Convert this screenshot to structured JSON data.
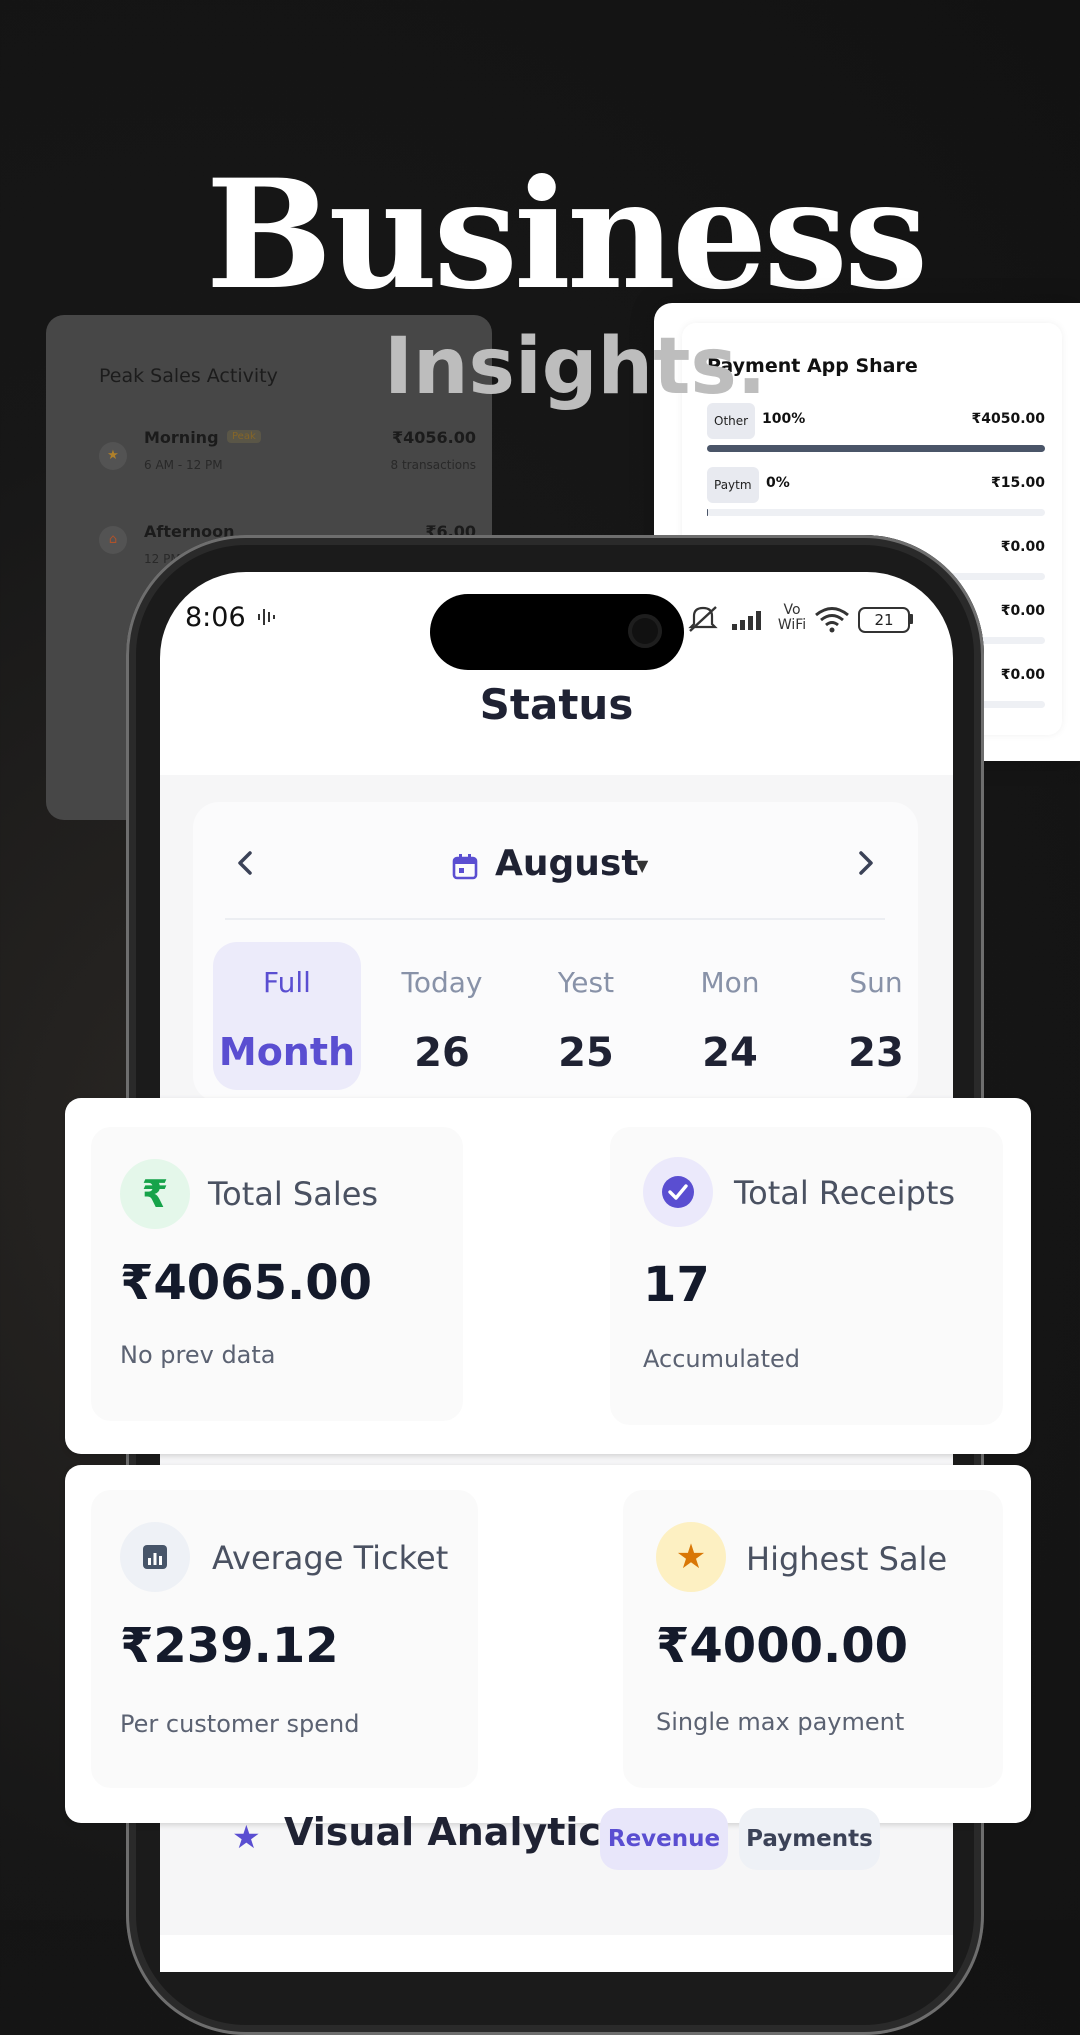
{
  "hero": {
    "title": "Business",
    "subtitle": "Insights."
  },
  "peak_sales": {
    "title": "Peak Sales Activity",
    "rows": [
      {
        "name": "Morning",
        "badge": "Peak",
        "time": "6 AM - 12 PM",
        "amount": "₹4056.00",
        "transactions": "8 transactions",
        "icon": "star-icon"
      },
      {
        "name": "Afternoon",
        "time": "12 PM",
        "amount": "₹6.00",
        "icon": "home-icon"
      }
    ]
  },
  "payment_share": {
    "title": "Payment App Share",
    "rows": [
      {
        "app": "Other",
        "percent": "100%",
        "amount": "₹4050.00",
        "share": 1.0
      },
      {
        "app": "Paytm",
        "percent": "0%",
        "amount": "₹15.00",
        "share": 0.004
      },
      {
        "amount": "₹0.00",
        "share": 0
      },
      {
        "amount": "₹0.00",
        "share": 0
      },
      {
        "amount": "₹0.00",
        "share": 0
      }
    ]
  },
  "status_bar": {
    "time": "8:06",
    "battery": "21",
    "network": "Vo WiFi"
  },
  "screen": {
    "title": "Status"
  },
  "month_selector": {
    "month": "August",
    "days": [
      {
        "top": "Full",
        "bottom": "Month",
        "active": true
      },
      {
        "top": "Today",
        "bottom": "26"
      },
      {
        "top": "Yest",
        "bottom": "25"
      },
      {
        "top": "Mon",
        "bottom": "24"
      },
      {
        "top": "Sun",
        "bottom": "23"
      }
    ]
  },
  "stats": {
    "total_sales": {
      "label": "Total Sales",
      "value": "₹4065.00",
      "sub": "No prev data",
      "icon": "rupee-icon",
      "color": "#16a34a"
    },
    "total_receipts": {
      "label": "Total Receipts",
      "value": "17",
      "sub": "Accumulated",
      "icon": "check-circle-icon",
      "color": "#5a4ed1"
    },
    "average_ticket": {
      "label": "Average Ticket",
      "value": "₹239.12",
      "sub": "Per customer spend",
      "icon": "bar-chart-icon",
      "color": "#475569"
    },
    "highest_sale": {
      "label": "Highest Sale",
      "value": "₹4000.00",
      "sub": "Single max payment",
      "icon": "star-icon",
      "color": "#d97706"
    }
  },
  "analytics": {
    "title": "Visual Analytics",
    "tabs": [
      "Revenue",
      "Payments"
    ]
  }
}
